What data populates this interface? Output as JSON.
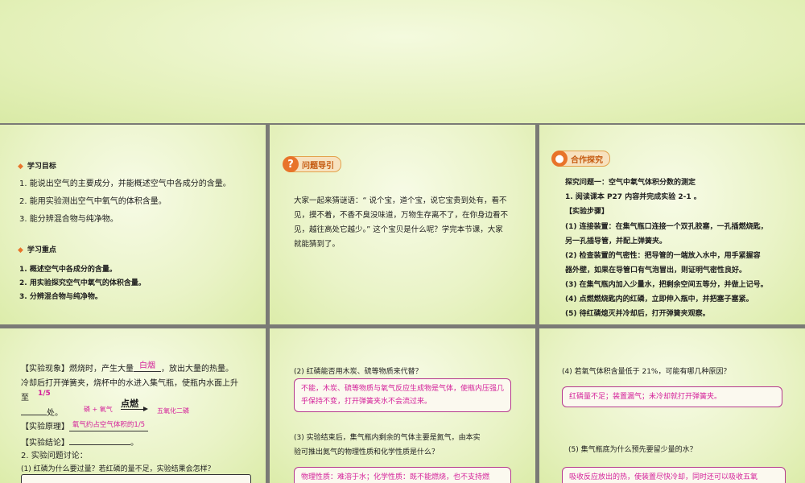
{
  "slide1": {
    "goals_heading": "学习目标",
    "goals": [
      "1. 能说出空气的主要成分，并能概述空气中各成分的含量。",
      "2. 能用实验测出空气中氧气的体积含量。",
      "3. 能分辨混合物与纯净物。"
    ],
    "focus_heading": "学习重点",
    "focus": [
      "1. 概述空气中各成分的含量。",
      "2. 用实验探究空气中氧气的体积含量。",
      "3. 分辨混合物与纯净物。"
    ]
  },
  "slide2": {
    "badge_icon": "?",
    "badge": "问题导引",
    "paragraph": "大家一起来猜谜语：“ 说个宝，道个宝，说它宝贵到处有，看不见，摸不着，不香不臭没味道，万物生存离不了，在你身边看不见，越往高处它越少。” 这个宝贝是什么呢？学完本节课，大家就能猜到了。"
  },
  "slide3": {
    "badge": "合作探究",
    "lines": [
      "探究问题一：空气中氧气体积分数的测定",
      "1. 阅读课本 P27 内容并完成实验 2-1 。",
      "【实验步骤】",
      "(1) 连接装置：在集气瓶口连接一个双孔胶塞，一孔插燃烧匙，",
      "另一孔插导管，并配上弹簧夹。",
      "(2) 检查装置的气密性：把导管的一端放入水中，用手紧握容",
      "器外壁，如果在导管口有气泡冒出，则证明气密性良好。",
      "(3) 在集气瓶内加入少量水，把剩余空间五等分，并做上记号。",
      "(4) 点燃燃烧匙内的红磷，立即伸入瓶中，并把塞子塞紧。",
      "(5) 待红磷熄灭并冷却后，打开弹簧夹观察。"
    ]
  },
  "slide4": {
    "phenomenon_pre": "【实验现象】燃烧时，产生大量",
    "phenomenon_answer": "白烟",
    "phenomenon_post": "，放出大量的热量。",
    "line2": "冷却后打开弹簧夹，烧杯中的水进入集气瓶，使瓶内水面上升",
    "to": "至",
    "fraction": "1/5",
    "place": "处。",
    "reactants": "磷 + 氧气",
    "condition": "点燃",
    "product": "五氧化二磷",
    "principle_label": "【实验原理】",
    "principle_answer": "氧气约占空气体积的1/5",
    "conclusion_label": "【实验结论】",
    "conclusion_end": "。",
    "discussion": "2. 实验问题讨论：",
    "q1": "(1) 红磷为什么要过量？若红磷的量不足，实验结果会怎样？"
  },
  "slide5": {
    "q2": "(2) 红磷能否用木炭、硫等物质来代替？",
    "a2": "不能，木炭、硫等物质与氧气反应生成物是气体，使瓶内压强几乎保持不变，打开弹簧夹水不会流过来。",
    "q3_line1": "(3) 实验结束后，集气瓶内剩余的气体主要是氮气，由本实",
    "q3_line2": "验可推出氮气的物理性质和化学性质是什么？",
    "a3": "物理性质：难溶于水；化学性质：既不能燃烧，也不支持燃"
  },
  "slide6": {
    "q4": "(4) 若氧气体积含量低于 21%，可能有哪几种原因？",
    "a4": "红磷量不足；装置漏气；未冷却就打开弹簧夹。",
    "q5": "(5) 集气瓶底为什么预先要留少量的水？",
    "a5": "吸收反应放出的热，使装置尽快冷却，同时还可以吸收五氧"
  }
}
